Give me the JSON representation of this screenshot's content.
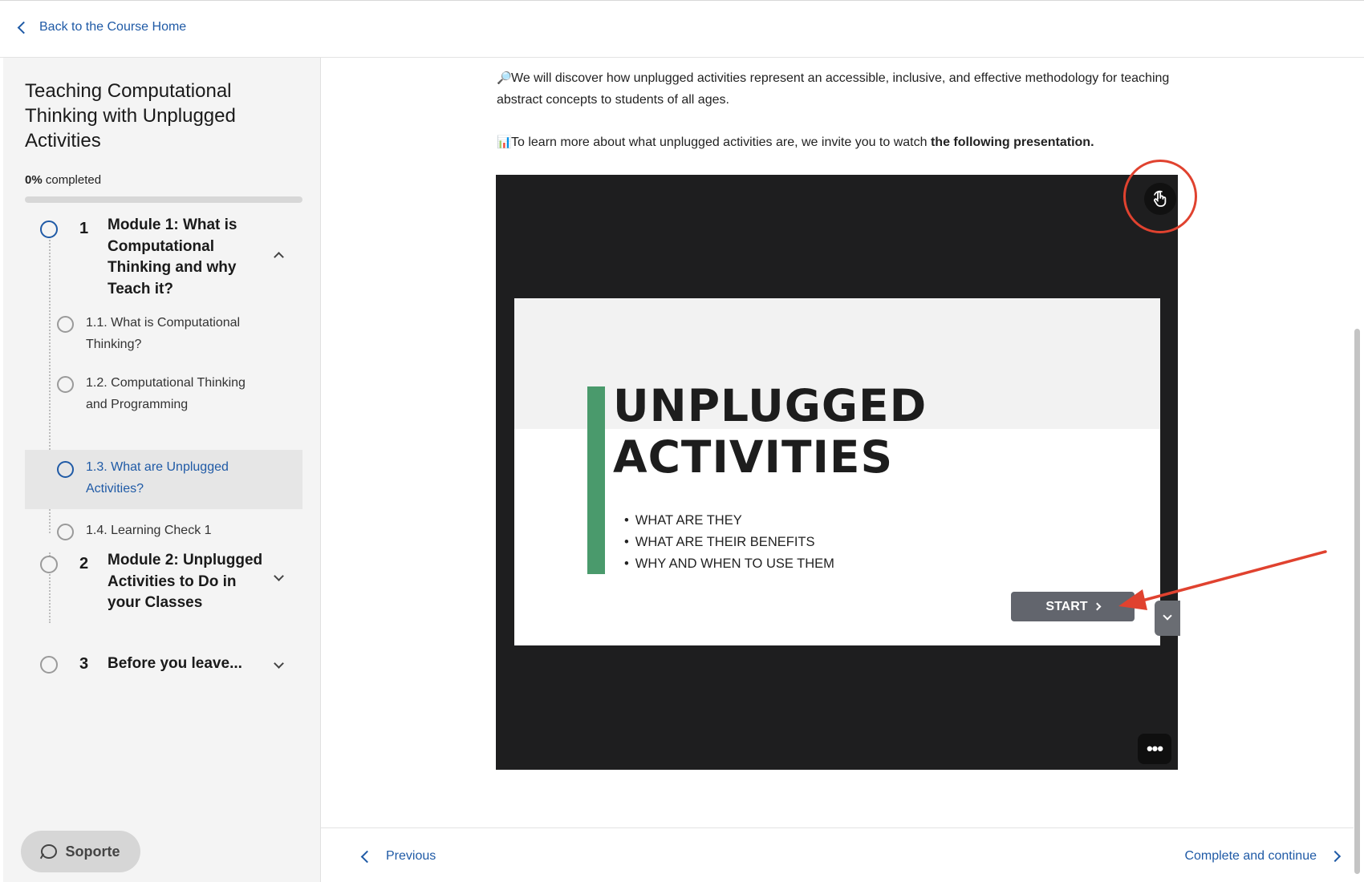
{
  "header": {
    "back_label": "Back to the Course Home"
  },
  "sidebar": {
    "course_title": "Teaching Computational Thinking with Unplugged Activities",
    "progress_percent": "0%",
    "progress_label": "completed",
    "progress_value": 0,
    "modules": [
      {
        "number": "1",
        "title": "Module 1: What is Computational Thinking and why Teach it?",
        "expanded": true,
        "lessons": [
          {
            "label": "1.1. What is Computational Thinking?"
          },
          {
            "label": "1.2. Computational Thinking and Programming"
          },
          {
            "label": "1.3. What are Unplugged Activities?",
            "active": true
          },
          {
            "label": "1.4. Learning Check 1"
          }
        ]
      },
      {
        "number": "2",
        "title": "Module 2: Unplugged Activities to Do in your Classes",
        "expanded": false
      },
      {
        "number": "3",
        "title": "Before you leave...",
        "expanded": false
      }
    ],
    "support_label": "Soporte"
  },
  "main": {
    "para1_emoji": "🔎",
    "para1": "We will discover how unplugged activities represent an accessible, inclusive, and effective methodology for teaching abstract concepts to students of all ages.",
    "para2_emoji": "📊",
    "para2_text": "To learn more about what unplugged activities are, we invite you to watch ",
    "para2_bold": "the following presentation.",
    "slide": {
      "title_line1": "UNPLUGGED",
      "title_line2": "ACTIVITIES",
      "bullets": [
        "WHAT ARE THEY",
        "WHAT ARE THEIR BENEFITS",
        "WHY AND WHEN TO USE THEM"
      ],
      "start_label": "START"
    },
    "more_label": "•••"
  },
  "footer": {
    "prev_label": "Previous",
    "next_label": "Complete and continue"
  },
  "colors": {
    "accent": "#1f5aa6",
    "slide_bar": "#4a9a6c",
    "annotation": "#e0422f"
  }
}
